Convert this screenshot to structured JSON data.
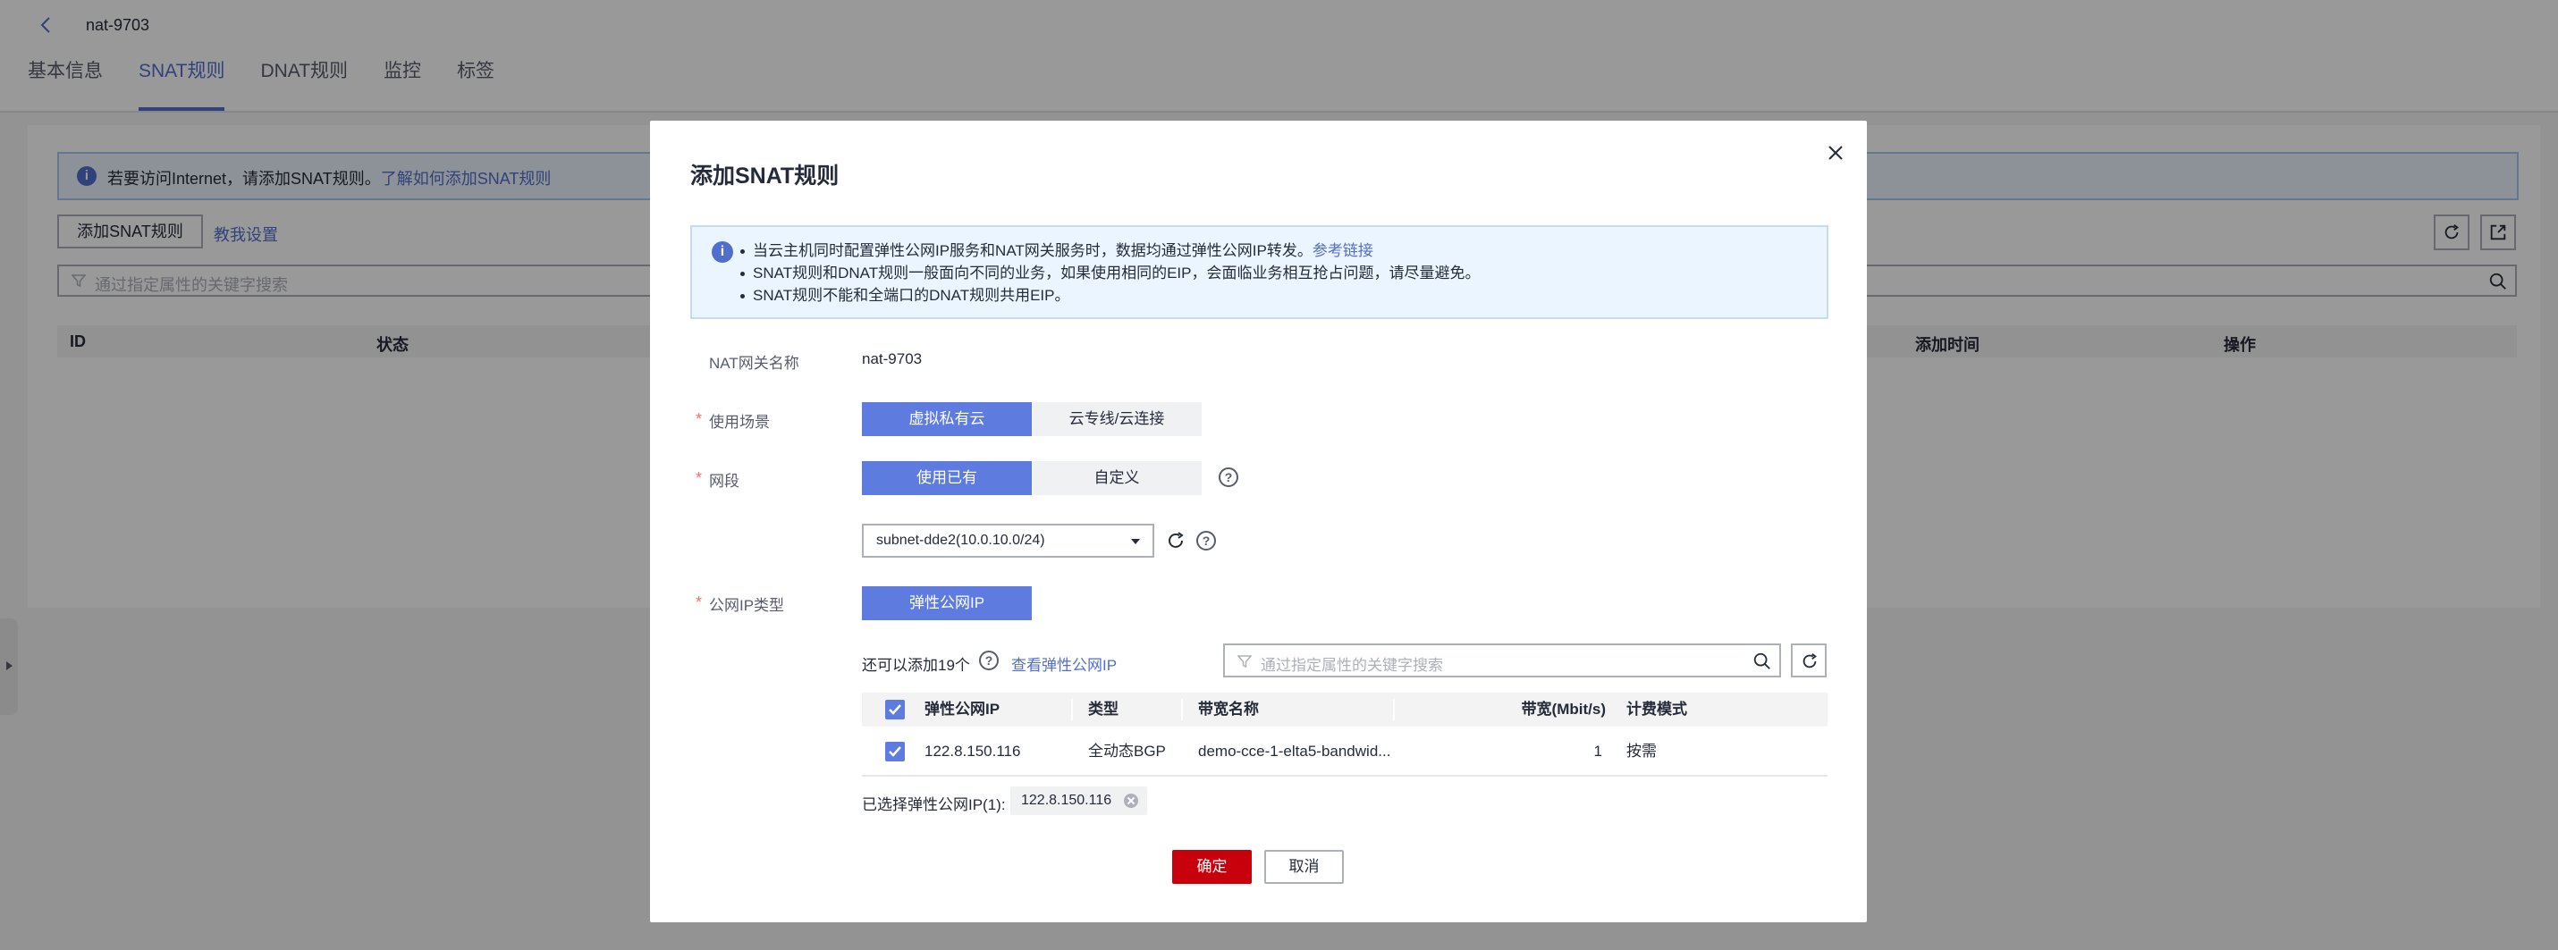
{
  "header": {
    "gateway_name": "nat-9703",
    "tabs": [
      {
        "label": "基本信息"
      },
      {
        "label": "SNAT规则"
      },
      {
        "label": "DNAT规则"
      },
      {
        "label": "监控"
      },
      {
        "label": "标签"
      }
    ]
  },
  "background": {
    "info_text": "若要访问Internet，请添加SNAT规则。",
    "info_link": "了解如何添加SNAT规则",
    "add_button": "添加SNAT规则",
    "help_link": "教我设置",
    "search_placeholder": "通过指定属性的关键字搜索",
    "columns": [
      "ID",
      "状态",
      "添加时间",
      "操作"
    ]
  },
  "modal": {
    "title": "添加SNAT规则",
    "notice": {
      "line1": "当云主机同时配置弹性公网IP服务和NAT网关服务时，数据均通过弹性公网IP转发。",
      "line1_link": "参考链接",
      "line2": "SNAT规则和DNAT规则一般面向不同的业务，如果使用相同的EIP，会面临业务相互抢占问题，请尽量避免。",
      "line3": "SNAT规则不能和全端口的DNAT规则共用EIP。"
    },
    "gateway_label": "NAT网关名称",
    "gateway_value": "nat-9703",
    "scenario": {
      "label": "使用场景",
      "options": [
        "虚拟私有云",
        "云专线/云连接"
      ],
      "selected": "虚拟私有云"
    },
    "subnet": {
      "label": "网段",
      "options": [
        "使用已有",
        "自定义"
      ],
      "selected": "使用已有",
      "select_value": "subnet-dde2(10.0.10.0/24)"
    },
    "ip_type": {
      "label": "公网IP类型",
      "option": "弹性公网IP"
    },
    "eip": {
      "count_text": "还可以添加19个",
      "view_link": "查看弹性公网IP",
      "search_placeholder": "通过指定属性的关键字搜索",
      "columns": [
        "弹性公网IP",
        "类型",
        "带宽名称",
        "带宽(Mbit/s)",
        "计费模式"
      ],
      "rows": [
        {
          "ip": "122.8.150.116",
          "type": "全动态BGP",
          "bw_name": "demo-cce-1-elta5-bandwid...",
          "bw": "1",
          "billing": "按需",
          "checked": true
        }
      ]
    },
    "selected_label": "已选择弹性公网IP(1):",
    "selected_chip": "122.8.150.116",
    "ok_label": "确定",
    "cancel_label": "取消"
  },
  "colors": {
    "brand": "#526ecc",
    "primary_button": "#c7000b",
    "segment_active": "#5e7ce0",
    "required": "#f66f6a"
  }
}
